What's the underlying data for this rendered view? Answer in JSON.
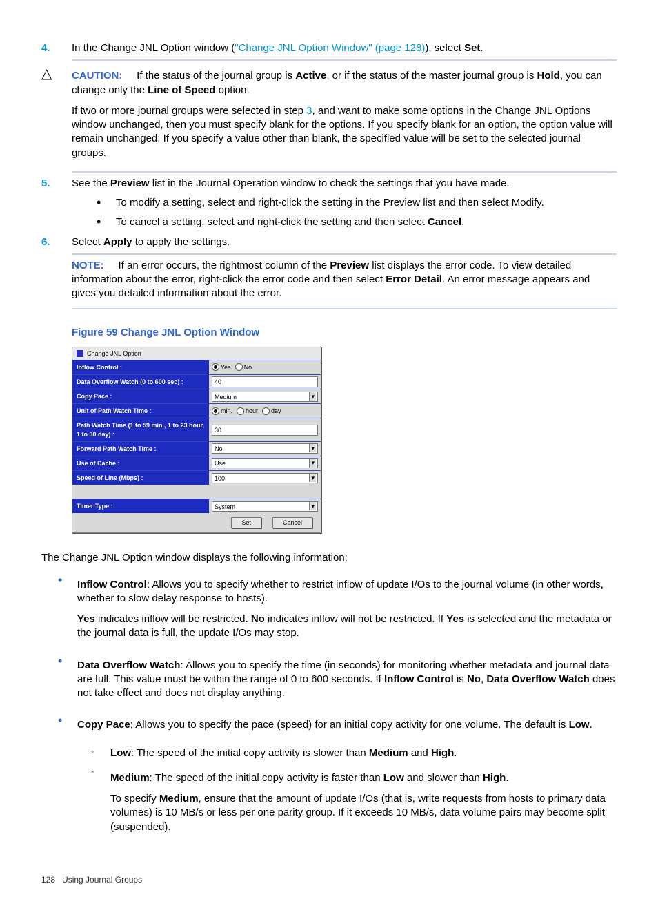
{
  "step4": {
    "num": "4.",
    "pre": "In the Change JNL Option window (",
    "link": "\"Change JNL Option Window\" (page 128)",
    "mid": "), select ",
    "set": "Set",
    "post": "."
  },
  "caution": {
    "label": "CAUTION:",
    "line1_a": "If the status of the journal group is ",
    "active": "Active",
    "line1_b": ", or if the status of the master journal group is ",
    "hold": "Hold",
    "line1_c": ", you can change only the ",
    "los": "Line of Speed",
    "line1_d": " option.",
    "para2_a": "If two or more journal groups were selected in step ",
    "step3": "3",
    "para2_b": ", and want to make some options in the Change JNL Options window unchanged, then you must specify blank for the options. If you specify blank for an option, the option value will remain unchanged. If you specify a value other than blank, the specified value will be set to the selected journal groups."
  },
  "step5": {
    "num": "5.",
    "a": "See the ",
    "preview": "Preview",
    "b": " list in the Journal Operation window to check the settings that you have made.",
    "bullet1": "To modify a setting, select and right-click the setting in the Preview list and then select Modify.",
    "bullet2_a": "To cancel a setting, select and right-click the setting and then select ",
    "cancel": "Cancel",
    "bullet2_b": "."
  },
  "step6": {
    "num": "6.",
    "a": "Select ",
    "apply": "Apply",
    "b": " to apply the settings."
  },
  "note": {
    "label": "NOTE:",
    "a": "If an error occurs, the rightmost column of the ",
    "preview": "Preview",
    "b": " list displays the error code. To view detailed information about the error, right-click the error code and then select ",
    "ed": "Error Detail",
    "c": ". An error message appears and gives you detailed information about the error."
  },
  "figure": {
    "caption": "Figure 59 Change JNL Option Window"
  },
  "ss": {
    "title": "Change JNL Option",
    "labels": {
      "inflow": "Inflow Control :",
      "overflow": "Data Overflow Watch (0 to 600 sec) :",
      "copypace": "Copy Pace :",
      "unit": "Unit of Path Watch Time :",
      "pathwatch": "Path Watch Time (1 to 59 min., 1 to 23 hour, 1 to 30 day) :",
      "forward": "Forward Path Watch Time :",
      "cache": "Use of Cache :",
      "speed": "Speed of Line (Mbps) :",
      "timer": "Timer Type :"
    },
    "values": {
      "yes": "Yes",
      "no_r": "No",
      "overflow_v": "40",
      "copypace_v": "Medium",
      "min": "min.",
      "hour": "hour",
      "day": "day",
      "pathwatch_v": "30",
      "forward_v": "No",
      "cache_v": "Use",
      "speed_v": "100",
      "timer_v": "System"
    },
    "buttons": {
      "set": "Set",
      "cancel": "Cancel"
    }
  },
  "after_fig": "The Change JNL Option window displays the following information:",
  "b_inflow": {
    "t": "Inflow Control",
    "a": ": Allows you to specify whether to restrict inflow of update I/Os to the journal volume (in other words, whether to slow delay response to hosts).",
    "p2_yes": "Yes",
    "p2_a": " indicates inflow will be restricted. ",
    "p2_no": "No",
    "p2_b": " indicates inflow will not be restricted. If ",
    "p2_yes2": "Yes",
    "p2_c": " is selected and the metadata or the journal data is full, the update I/Os may stop."
  },
  "b_overflow": {
    "t": "Data Overflow Watch",
    "a": ": Allows you to specify the time (in seconds) for monitoring whether metadata and journal data are full. This value must be within the range of 0 to 600 seconds. If ",
    "ic": "Inflow Control",
    "b": " is ",
    "no": "No",
    "c": ", ",
    "dow": "Data Overflow Watch",
    "d": " does not take effect and does not display anything."
  },
  "b_copy": {
    "t": "Copy Pace",
    "a": ": Allows you to specify the pace (speed) for an initial copy activity for one volume. The default is ",
    "low": "Low",
    "b": "."
  },
  "sub_low": {
    "t": "Low",
    "a": ": The speed of the initial copy activity is slower than ",
    "m": "Medium",
    "and": " and ",
    "h": "High",
    "b": "."
  },
  "sub_med": {
    "t": "Medium",
    "a": ": The speed of the initial copy activity is faster than ",
    "l": "Low",
    "and": " and slower than ",
    "h": "High",
    "b": ".",
    "p2_a": "To specify ",
    "p2_m": "Medium",
    "p2_b": ", ensure that the amount of update I/Os (that is, write requests from hosts to primary data volumes) is 10 MB/s or less per one parity group. If it exceeds 10 MB/s, data volume pairs may become split (suspended)."
  },
  "footer": {
    "page": "128",
    "title": "Using Journal Groups"
  }
}
